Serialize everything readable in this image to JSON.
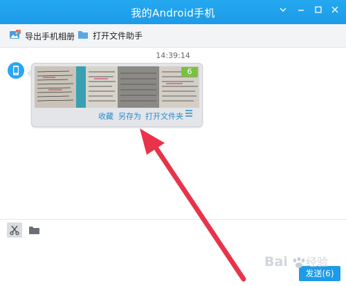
{
  "window": {
    "title": "我的Android手机",
    "controls": [
      "menu-icon",
      "minimize-icon",
      "maximize-icon",
      "close-icon"
    ]
  },
  "toolbar": {
    "export_label": "导出手机相册",
    "file_helper_label": "打开文件助手"
  },
  "chat": {
    "timestamp": "14:39:14",
    "message": {
      "image_count_badge": "6",
      "actions": {
        "favorite": "收藏",
        "save_as": "另存为",
        "open_folder": "打开文件夹"
      }
    }
  },
  "input": {
    "tools": [
      "scissors-icon",
      "folder-icon"
    ]
  },
  "send_button": {
    "label": "发送(6)"
  },
  "watermark": {
    "text": "Baidu经验"
  },
  "colors": {
    "titlebar": "#1d9be8",
    "badge": "#7ac143",
    "link": "#2a8bd0",
    "arrow": "#e8334a"
  }
}
